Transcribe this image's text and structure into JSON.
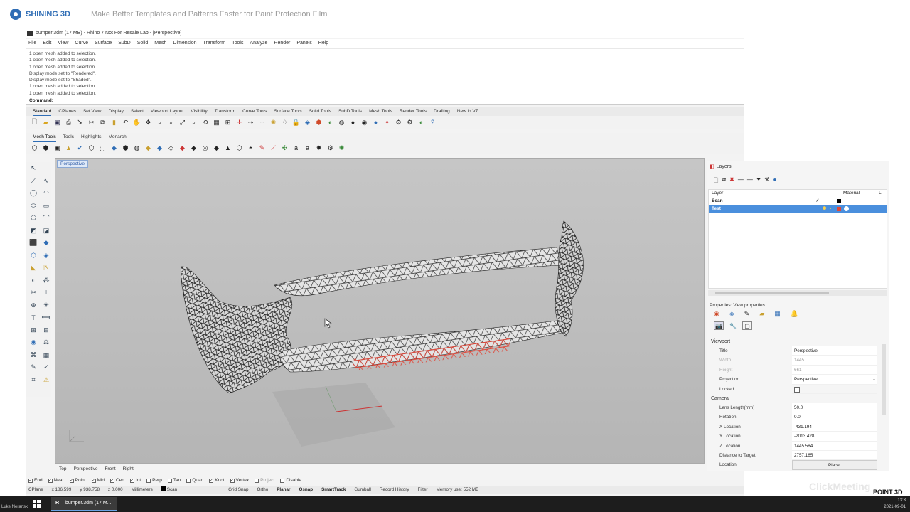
{
  "webinar": {
    "brand": "SHINING 3D",
    "title": "Make Better Templates and Patterns Faster for Paint Protection Film"
  },
  "window": {
    "title": "bumper.3dm (17 MB) - Rhino 7 Not For Resale Lab - [Perspective]"
  },
  "menu": [
    "File",
    "Edit",
    "View",
    "Curve",
    "Surface",
    "SubD",
    "Solid",
    "Mesh",
    "Dimension",
    "Transform",
    "Tools",
    "Analyze",
    "Render",
    "Panels",
    "Help"
  ],
  "history": [
    "1 open mesh added to selection.",
    "1 open mesh added to selection.",
    "1 open mesh added to selection.",
    "Display mode set to \"Rendered\".",
    "Display mode set to \"Shaded\".",
    "1 open mesh added to selection.",
    "1 open mesh added to selection."
  ],
  "command": {
    "label": "Command:",
    "value": ""
  },
  "toolbar_tabs": [
    "Standard",
    "CPlanes",
    "Set View",
    "Display",
    "Select",
    "Viewport Layout",
    "Visibility",
    "Transform",
    "Curve Tools",
    "Surface Tools",
    "Solid Tools",
    "SubD Tools",
    "Mesh Tools",
    "Render Tools",
    "Drafting",
    "New in V7"
  ],
  "toolbar_tabs2": [
    "Mesh Tools",
    "Tools",
    "Highlights",
    "Monarch"
  ],
  "viewport": {
    "label": "Perspective",
    "tabs": [
      "Top",
      "Perspective",
      "Front",
      "Right"
    ]
  },
  "osnaps": [
    {
      "label": "End",
      "on": true
    },
    {
      "label": "Near",
      "on": true
    },
    {
      "label": "Point",
      "on": true
    },
    {
      "label": "Mid",
      "on": true
    },
    {
      "label": "Cen",
      "on": true
    },
    {
      "label": "Int",
      "on": true
    },
    {
      "label": "Perp",
      "on": false
    },
    {
      "label": "Tan",
      "on": false
    },
    {
      "label": "Quad",
      "on": false
    },
    {
      "label": "Knot",
      "on": true
    },
    {
      "label": "Vertex",
      "on": true
    },
    {
      "label": "Project",
      "on": false
    },
    {
      "label": "Disable",
      "on": false
    }
  ],
  "status": {
    "cplane": "CPlane",
    "x": "x 186.599",
    "y": "y 938.758",
    "z": "z 0.000",
    "units": "Millimeters",
    "layer": "Scan",
    "toggles": [
      "Grid Snap",
      "Ortho",
      "Planar",
      "Osnap",
      "SmartTrack",
      "Gumball",
      "Record History",
      "Filter"
    ],
    "memory": "Memory use: 552 MB"
  },
  "layers": {
    "title": "Layers",
    "columns": {
      "layer": "Layer",
      "material": "Material",
      "linetype": "Li"
    },
    "rows": [
      {
        "name": "Scan",
        "check": "✓",
        "selected": false
      },
      {
        "name": "Test",
        "check": "",
        "selected": true
      }
    ]
  },
  "properties": {
    "title": "Properties: View properties",
    "sections": {
      "viewport": "Viewport",
      "camera": "Camera"
    },
    "viewport_rows": [
      {
        "k": "Title",
        "v": "Perspective",
        "dim": false
      },
      {
        "k": "Width",
        "v": "1445",
        "dim": true
      },
      {
        "k": "Height",
        "v": "661",
        "dim": true
      },
      {
        "k": "Projection",
        "v": "Perspective",
        "dim": false
      },
      {
        "k": "Locked",
        "v": "",
        "dim": false
      }
    ],
    "camera_rows": [
      {
        "k": "Lens Length(mm)",
        "v": "50.0"
      },
      {
        "k": "Rotation",
        "v": "0.0"
      },
      {
        "k": "X Location",
        "v": "-431.194"
      },
      {
        "k": "Y Location",
        "v": "-2013.428"
      },
      {
        "k": "Z Location",
        "v": "1445.584"
      },
      {
        "k": "Distance to Target",
        "v": "2757.165"
      },
      {
        "k": "Location",
        "v": "Place..."
      }
    ]
  },
  "taskbar": {
    "item": "bumper.3dm (17 M...",
    "presenter": "Luke Neranski",
    "time": "13:3",
    "date": "2021-09-01"
  },
  "watermark": "ClickMeeting",
  "corner_logo": "POINT 3D",
  "colors": {
    "accent": "#2f6db5",
    "selection": "#4a8fdd",
    "mesh_highlight": "#e0483a"
  }
}
